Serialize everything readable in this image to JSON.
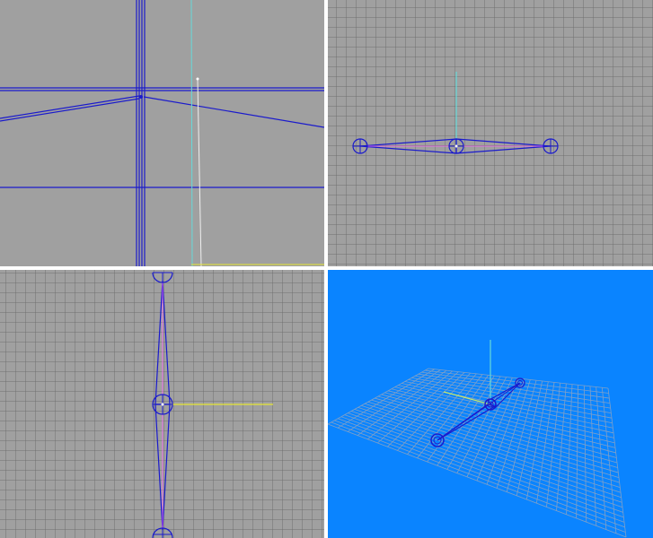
{
  "window": {
    "layout": "quad-view"
  },
  "viewports": [
    {
      "id": "top-left",
      "kind": "perspective-closeup",
      "background": "#a0a0a0",
      "grid": false
    },
    {
      "id": "top-right",
      "kind": "orthographic-front",
      "background": "#a0a0a0",
      "grid": true
    },
    {
      "id": "bottom-left",
      "kind": "orthographic-side",
      "background": "#a0a0a0",
      "grid": true
    },
    {
      "id": "bottom-right",
      "kind": "perspective-3d",
      "background": "#0a84ff",
      "grid": true,
      "active": true
    }
  ],
  "colors": {
    "viewport_bg": "#a0a0a0",
    "active_viewport_bg": "#0a84ff",
    "grid_line": "#6f6f6f",
    "grid_3d": "#7fa0c8",
    "bone_wire": "#1a1acc",
    "axis_y": "#66d9d9",
    "axis_x": "#e6e633",
    "selected_wire": "#ff66ff",
    "white_line": "#f0f0f0",
    "separator": "#ffffff"
  },
  "icons": [
    "bone-joint-icon",
    "axis-gizmo-icon"
  ]
}
